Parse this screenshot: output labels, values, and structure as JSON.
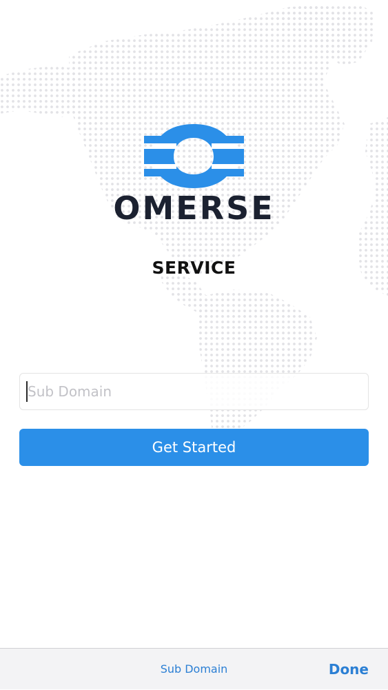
{
  "brand": {
    "name": "OMERSE",
    "subtitle": "SERVICE",
    "logo_icon": "omerse-ring-logo-icon",
    "colors": {
      "accent": "#2b8fe8",
      "dark": "#1b2130"
    }
  },
  "background": {
    "icon": "dotted-world-map",
    "dot_color": "#e2e2e6"
  },
  "form": {
    "sub_domain_placeholder": "Sub Domain",
    "sub_domain_value": "",
    "submit_label": "Get Started"
  },
  "keyboard_bar": {
    "title": "Sub Domain",
    "done_label": "Done",
    "accent": "#2b7fd4"
  }
}
